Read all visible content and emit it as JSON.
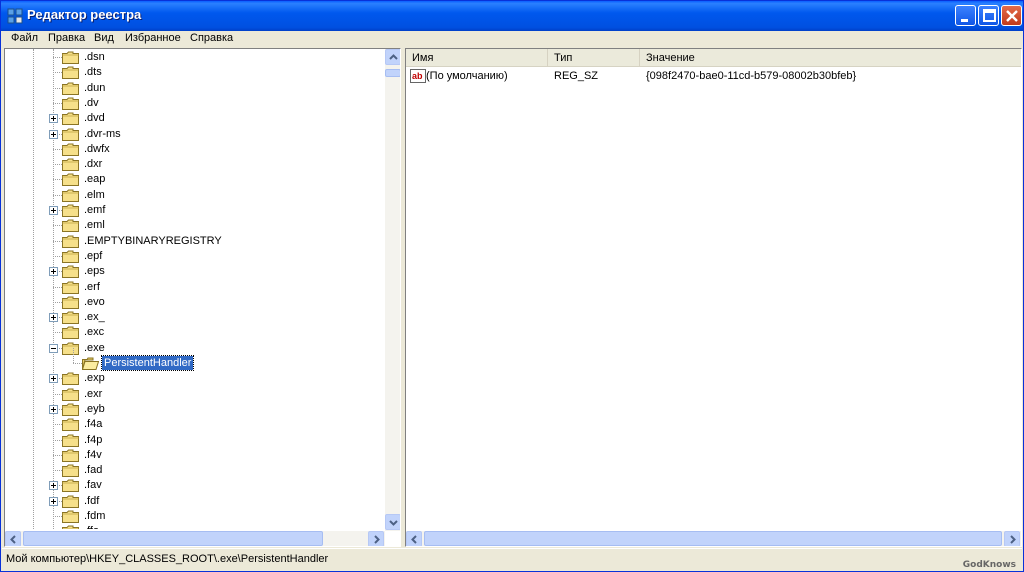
{
  "window": {
    "title": "Редактор реестра"
  },
  "menu": [
    "Файл",
    "Правка",
    "Вид",
    "Избранное",
    "Справка"
  ],
  "tree": {
    "items": [
      {
        "label": ".dsn",
        "expander": ""
      },
      {
        "label": ".dts",
        "expander": ""
      },
      {
        "label": ".dun",
        "expander": ""
      },
      {
        "label": ".dv",
        "expander": ""
      },
      {
        "label": ".dvd",
        "expander": "plus"
      },
      {
        "label": ".dvr-ms",
        "expander": "plus"
      },
      {
        "label": ".dwfx",
        "expander": ""
      },
      {
        "label": ".dxr",
        "expander": ""
      },
      {
        "label": ".eap",
        "expander": ""
      },
      {
        "label": ".elm",
        "expander": ""
      },
      {
        "label": ".emf",
        "expander": "plus"
      },
      {
        "label": ".eml",
        "expander": ""
      },
      {
        "label": ".EMPTYBINARYREGISTRY",
        "expander": ""
      },
      {
        "label": ".epf",
        "expander": ""
      },
      {
        "label": ".eps",
        "expander": "plus"
      },
      {
        "label": ".erf",
        "expander": ""
      },
      {
        "label": ".evo",
        "expander": ""
      },
      {
        "label": ".ex_",
        "expander": "plus"
      },
      {
        "label": ".exc",
        "expander": ""
      },
      {
        "label": ".exe",
        "expander": "minus"
      },
      {
        "label": "PersistentHandler",
        "expander": "",
        "child": true,
        "selected": true
      },
      {
        "label": ".exp",
        "expander": "plus"
      },
      {
        "label": ".exr",
        "expander": ""
      },
      {
        "label": ".eyb",
        "expander": "plus"
      },
      {
        "label": ".f4a",
        "expander": ""
      },
      {
        "label": ".f4p",
        "expander": ""
      },
      {
        "label": ".f4v",
        "expander": ""
      },
      {
        "label": ".fad",
        "expander": ""
      },
      {
        "label": ".fav",
        "expander": "plus"
      },
      {
        "label": ".fdf",
        "expander": "plus"
      },
      {
        "label": ".fdm",
        "expander": ""
      },
      {
        "label": ".ffa",
        "expander": ""
      }
    ]
  },
  "list": {
    "columns": [
      "Имя",
      "Тип",
      "Значение"
    ],
    "rows": [
      {
        "name": "(По умолчанию)",
        "type": "REG_SZ",
        "value": "{098f2470-bae0-11cd-b579-08002b30bfeb}",
        "icon": "string-value-icon"
      }
    ]
  },
  "status": {
    "path": "Мой компьютер\\HKEY_CLASSES_ROOT\\.exe\\PersistentHandler"
  },
  "watermark": "GodKnows",
  "colors": {
    "titlebar": "#0058ee",
    "selection": "#316ac5",
    "folder": "#f6e08a",
    "close": "#c13a1c"
  }
}
